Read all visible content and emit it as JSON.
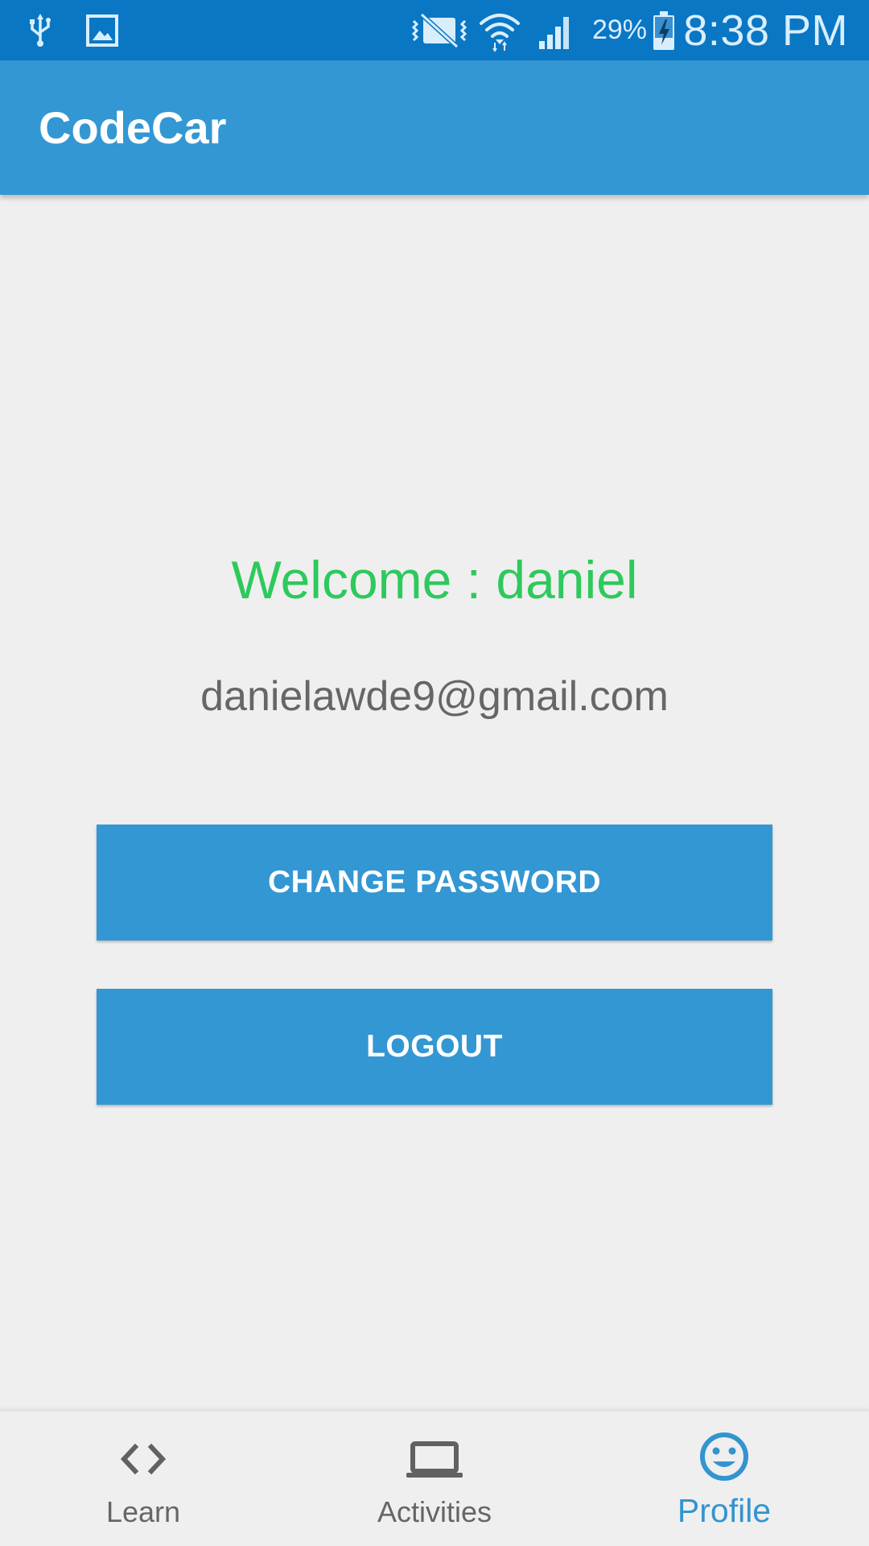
{
  "status_bar": {
    "time": "8:38 PM",
    "battery_percent": "29%",
    "icons": [
      "usb-icon",
      "image-icon",
      "vibrate-mute-icon",
      "wifi-icon",
      "signal-icon",
      "battery-charging-icon"
    ]
  },
  "app_bar": {
    "title": "CodeCar"
  },
  "profile": {
    "welcome_text": "Welcome : daniel",
    "email": "danielawde9@gmail.com"
  },
  "buttons": {
    "change_password": "CHANGE PASSWORD",
    "logout": "LOGOUT"
  },
  "bottom_nav": {
    "items": [
      {
        "label": "Learn",
        "icon": "code-icon",
        "active": false
      },
      {
        "label": "Activities",
        "icon": "laptop-icon",
        "active": false
      },
      {
        "label": "Profile",
        "icon": "smiley-icon",
        "active": true
      }
    ]
  },
  "colors": {
    "status_bar": "#0a77c4",
    "primary": "#3397d3",
    "welcome_green": "#2ec95c",
    "background": "#efefef",
    "active_nav": "#3394d0"
  }
}
